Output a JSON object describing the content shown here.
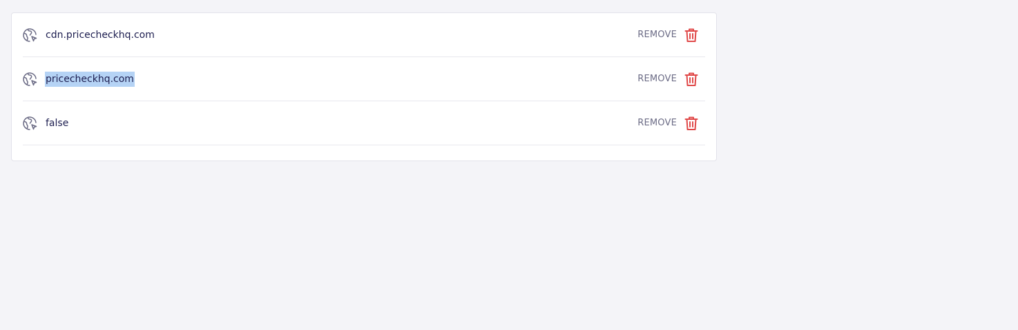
{
  "colors": {
    "background": "#f4f4f8",
    "card": "#ffffff",
    "text": "#1c1d4f",
    "muted": "#6b6b85",
    "danger": "#e04848",
    "selection": "#b5d3f5"
  },
  "domains": {
    "items": [
      {
        "name": "cdn.pricecheckhq.com",
        "icon": "globe-cursor-icon",
        "action_label": "REMOVE",
        "action_icon": "trash-icon",
        "selected": false
      },
      {
        "name": "pricecheckhq.com",
        "icon": "globe-cursor-icon",
        "action_label": "REMOVE",
        "action_icon": "trash-icon",
        "selected": true
      },
      {
        "name": "false",
        "icon": "globe-cursor-icon",
        "action_label": "REMOVE",
        "action_icon": "trash-icon",
        "selected": false
      }
    ]
  }
}
